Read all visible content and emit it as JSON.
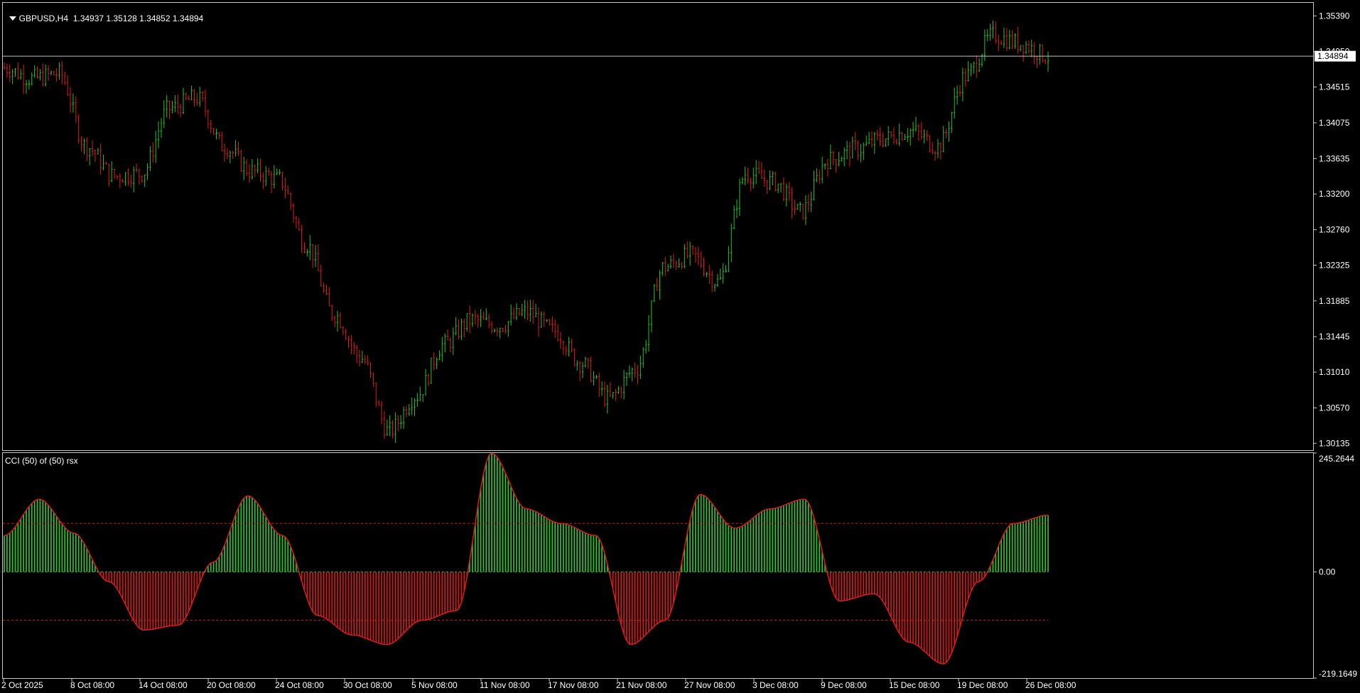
{
  "main_panel": {
    "symbol": "GBPUSD,H4",
    "ohlc": "1.34937 1.35128 1.34852 1.34894",
    "price_levels": [
      "1.35390",
      "1.34950",
      "1.34515",
      "1.34075",
      "1.33635",
      "1.33200",
      "1.32760",
      "1.32325",
      "1.31885",
      "1.31445",
      "1.31010",
      "1.30570",
      "1.30135"
    ],
    "current_price": "1.34894",
    "colors": {
      "bull": "#22c422",
      "bear": "#e01a1a",
      "frame": "#c8c8c8",
      "price_line": "#c0c0c0"
    }
  },
  "indicator_panel": {
    "title": "CCI (50) of (50) rsx",
    "scale_top": "245.2644",
    "scale_zero": "0.00",
    "scale_bottom": "-219.1649",
    "colors": {
      "positive": "#32cd32",
      "negative": "#e01a1a",
      "level_upper": "#c82020",
      "level_zero": "#32b432"
    }
  },
  "time_axis": {
    "labels": [
      "2 Oct 2025",
      "8 Oct 08:00",
      "14 Oct 08:00",
      "20 Oct 08:00",
      "24 Oct 08:00",
      "30 Oct 08:00",
      "5 Nov 08:00",
      "11 Nov 08:00",
      "17 Nov 08:00",
      "21 Nov 08:00",
      "27 Nov 08:00",
      "3 Dec 08:00",
      "9 Dec 08:00",
      "15 Dec 08:00",
      "19 Dec 08:00",
      "26 Dec 08:00"
    ]
  },
  "chart_data": [
    {
      "type": "candlestick",
      "title": "GBPUSD,H4",
      "ylim": [
        1.3005,
        1.3555
      ],
      "current_price": 1.34894,
      "path_anchors": [
        {
          "x": "2 Oct 2025",
          "y": 1.3475
        },
        {
          "x": "5 Oct",
          "y": 1.3462
        },
        {
          "x": "7 Oct",
          "y": 1.3468
        },
        {
          "x": "10 Oct",
          "y": 1.3378
        },
        {
          "x": "12 Oct",
          "y": 1.3342
        },
        {
          "x": "14 Oct",
          "y": 1.3345
        },
        {
          "x": "16 Oct",
          "y": 1.3425
        },
        {
          "x": "18 Oct",
          "y": 1.3438
        },
        {
          "x": "21 Oct",
          "y": 1.3378
        },
        {
          "x": "23 Oct",
          "y": 1.3348
        },
        {
          "x": "25 Oct",
          "y": 1.3338
        },
        {
          "x": "27 Oct",
          "y": 1.3258
        },
        {
          "x": "29 Oct",
          "y": 1.3172
        },
        {
          "x": "31 Oct",
          "y": 1.3118
        },
        {
          "x": "4 Nov",
          "y": 1.3028
        },
        {
          "x": "5 Nov",
          "y": 1.3072
        },
        {
          "x": "7 Nov",
          "y": 1.3135
        },
        {
          "x": "10 Nov",
          "y": 1.3165
        },
        {
          "x": "12 Nov",
          "y": 1.3158
        },
        {
          "x": "14 Nov",
          "y": 1.3175
        },
        {
          "x": "17 Nov",
          "y": 1.3152
        },
        {
          "x": "19 Nov",
          "y": 1.3112
        },
        {
          "x": "20 Nov",
          "y": 1.3068
        },
        {
          "x": "24 Nov",
          "y": 1.3105
        },
        {
          "x": "26 Nov",
          "y": 1.323
        },
        {
          "x": "27 Nov",
          "y": 1.3245
        },
        {
          "x": "1 Dec",
          "y": 1.3212
        },
        {
          "x": "3 Dec",
          "y": 1.3345
        },
        {
          "x": "5 Dec",
          "y": 1.3335
        },
        {
          "x": "9 Dec",
          "y": 1.3298
        },
        {
          "x": "10 Dec",
          "y": 1.3362
        },
        {
          "x": "12 Dec",
          "y": 1.3375
        },
        {
          "x": "15 Dec",
          "y": 1.3388
        },
        {
          "x": "17 Dec",
          "y": 1.3398
        },
        {
          "x": "18 Dec",
          "y": 1.3378
        },
        {
          "x": "22 Dec",
          "y": 1.3465
        },
        {
          "x": "23 Dec",
          "y": 1.3515
        },
        {
          "x": "26 Dec",
          "y": 1.3505
        },
        {
          "x": "29 Dec",
          "y": 1.3489
        }
      ]
    },
    {
      "type": "histogram",
      "title": "CCI (50) of (50) rsx",
      "ylim": [
        -219.1649,
        245.2644
      ],
      "levels": [
        100,
        0,
        -100
      ],
      "path_anchors": [
        {
          "x": "2 Oct 2025",
          "y": 75
        },
        {
          "x": "4 Oct",
          "y": 150
        },
        {
          "x": "8 Oct",
          "y": 80
        },
        {
          "x": "11 Oct",
          "y": -20
        },
        {
          "x": "13 Oct",
          "y": -120
        },
        {
          "x": "15 Oct",
          "y": -110
        },
        {
          "x": "17 Oct",
          "y": 20
        },
        {
          "x": "20 Oct",
          "y": 157
        },
        {
          "x": "23 Oct",
          "y": 75
        },
        {
          "x": "27 Oct",
          "y": -90
        },
        {
          "x": "30 Oct",
          "y": -130
        },
        {
          "x": "3 Nov",
          "y": -150
        },
        {
          "x": "5 Nov",
          "y": -100
        },
        {
          "x": "8 Nov",
          "y": -80
        },
        {
          "x": "11 Nov",
          "y": 245
        },
        {
          "x": "13 Nov",
          "y": 130
        },
        {
          "x": "17 Nov",
          "y": 100
        },
        {
          "x": "19 Nov",
          "y": 75
        },
        {
          "x": "21 Nov",
          "y": -150
        },
        {
          "x": "24 Nov",
          "y": -100
        },
        {
          "x": "27 Nov",
          "y": 160
        },
        {
          "x": "1 Dec",
          "y": 90
        },
        {
          "x": "5 Dec",
          "y": 130
        },
        {
          "x": "8 Dec",
          "y": 150
        },
        {
          "x": "11 Dec",
          "y": -60
        },
        {
          "x": "13 Dec",
          "y": -45
        },
        {
          "x": "16 Dec",
          "y": -145
        },
        {
          "x": "19 Dec",
          "y": -190
        },
        {
          "x": "23 Dec",
          "y": -20
        },
        {
          "x": "26 Dec",
          "y": 100
        },
        {
          "x": "29 Dec",
          "y": 117
        }
      ]
    }
  ]
}
